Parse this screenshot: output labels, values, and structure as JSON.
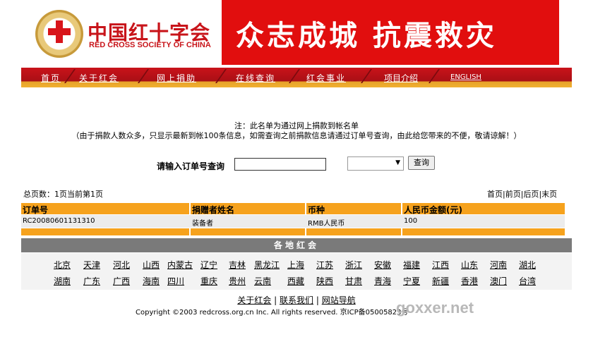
{
  "header": {
    "logo_cn": "中国红十字会",
    "logo_en": "RED CROSS SOCIETY OF CHINA",
    "banner": "众志成城  抗震救灾"
  },
  "nav": [
    "首页",
    "关于红会",
    "网上捐助",
    "在线查询",
    "红会事业",
    "项目介绍",
    "ENGLISH"
  ],
  "notice": {
    "line1": "注：此名单为通过网上捐款到帐名单",
    "line2": "（由于捐款人数众多，只显示最新到帐100条信息，如需查询之前捐款信息请通过订单号查询，由此给您带来的不便，敬请谅解！）"
  },
  "query": {
    "label": "请输入订单号查询",
    "input_value": "",
    "select_value": "",
    "button": "查询"
  },
  "paging": {
    "left": "总页数：1页当前第1页",
    "first": "首页",
    "prev": "前页",
    "next": "后页",
    "last": "末页"
  },
  "table": {
    "headers": [
      "订单号",
      "捐赠者姓名",
      "币种",
      "人民币金额(元)"
    ],
    "rows": [
      [
        "RC20080601131310",
        "装备者",
        "RMB人民币",
        "100"
      ]
    ]
  },
  "regions": {
    "title": "各地红会",
    "row1": [
      "北京",
      "天津",
      "河北",
      "山西",
      "内蒙古",
      "辽宁",
      "吉林",
      "黑龙江",
      "上海",
      "江苏",
      "浙江",
      "安徽",
      "福建",
      "江西",
      "山东",
      "河南",
      "湖北"
    ],
    "row2": [
      "湖南",
      "广东",
      "广西",
      "海南",
      "四川",
      "重庆",
      "贵州",
      "云南",
      "西藏",
      "陕西",
      "甘肃",
      "青海",
      "宁夏",
      "新疆",
      "香港",
      "澳门",
      "台湾"
    ]
  },
  "footer": {
    "about": "关于红会",
    "contact": "联系我们",
    "sitemap": "网站导航",
    "copyright": "Copyright ©2003 redcross.org.cn Inc. All rights reserved. 京ICP备05005823号"
  },
  "watermark": "goxxer.net",
  "colors": {
    "red": "#e10e0e",
    "orange": "#f6a21d",
    "gray": "#7a7a7a"
  }
}
